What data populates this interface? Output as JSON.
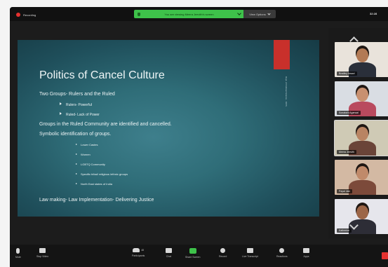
{
  "topbar": {
    "recording": "Recording",
    "viewing_banner": "You are viewing Meera Jeevith's screen",
    "view_options": "View Options",
    "time": "32:28"
  },
  "slide": {
    "title": "Politics of Cancel Culture",
    "side_text": "Dept. of Political Science · IRPS",
    "lines": [
      "Two Groups- Rulers and the Ruled",
      "Rulers- Powerful",
      "Ruled- Lack of Power",
      "Groups in the Ruled Community are identified and cancelled.",
      "Symbolic identification of groups.",
      "Lower Castes",
      "Women",
      "LGBTQ Community",
      "Specific tribal/ religious /ethnic groups",
      "North East states of India",
      "Law making- Law Implementation- Delivering Justice"
    ]
  },
  "participants": [
    {
      "name": "Bradley Ansari",
      "wall": "#e9e3db",
      "skin": "#b27a55",
      "shirt": "#2a2f3a"
    },
    {
      "name": "Sonakshi Agarwal",
      "wall": "#d9dde3",
      "skin": "#c89070",
      "shirt": "#b94a5e"
    },
    {
      "name": "Meera Jeevith",
      "wall": "#cfcab5",
      "skin": "#b98463",
      "shirt": "#6a4438"
    },
    {
      "name": "Payal Jain",
      "wall": "#d3b9a3",
      "skin": "#c08a6a",
      "shirt": "#7c4a3a"
    },
    {
      "name": "Katherine",
      "wall": "#e6e6ec",
      "skin": "#9c6648",
      "shirt": "#2d2d36"
    }
  ],
  "toolbar": {
    "mute": "Mute",
    "stop_video": "Stop Video",
    "participants": "Participants",
    "participants_count": "48",
    "chat": "Chat",
    "share_screen": "Share Screen",
    "record": "Record",
    "live_transcript": "Live Transcript",
    "reactions": "Reactions",
    "apps": "Apps"
  },
  "colors": {
    "accent_green": "#3ec24a",
    "recording_red": "#e5312f",
    "slide_accent": "#c8302b"
  }
}
